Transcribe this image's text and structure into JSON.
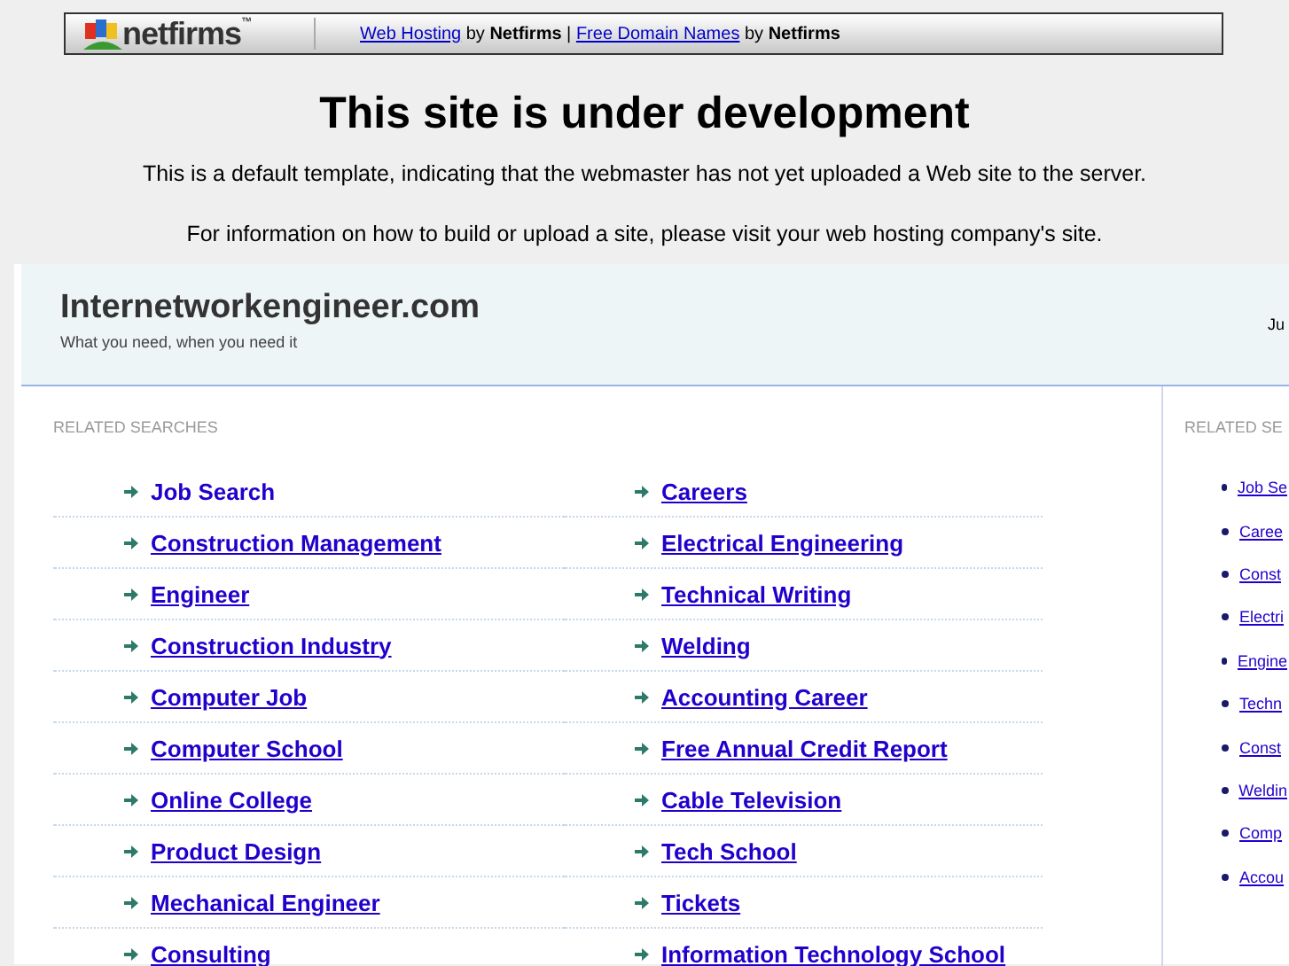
{
  "banner": {
    "logo_text": "netfirms",
    "logo_mark": "™",
    "parts": [
      {
        "kind": "link",
        "text": "Web Hosting"
      },
      {
        "kind": "plain",
        "text": " by "
      },
      {
        "kind": "bold",
        "text": "Netfirms"
      },
      {
        "kind": "plain",
        "text": " | "
      },
      {
        "kind": "link",
        "text": "Free Domain Names"
      },
      {
        "kind": "plain",
        "text": " by "
      },
      {
        "kind": "bold",
        "text": "Netfirms"
      }
    ]
  },
  "heading": "This site is under development",
  "paragraphs": [
    "This is a default template, indicating that the webmaster has not yet uploaded a Web site to the server.",
    "For information on how to build or upload a site, please visit your web hosting company's site."
  ],
  "site": {
    "title": "Internetworkengineer.com",
    "tagline": "What you need, when you need it",
    "header_right": "Ju"
  },
  "related": {
    "title": "RELATED SEARCHES",
    "links": [
      {
        "text": "Job Search",
        "hovered": true
      },
      {
        "text": "Careers",
        "hovered": false
      },
      {
        "text": "Construction Management",
        "hovered": false
      },
      {
        "text": "Electrical Engineering",
        "hovered": false
      },
      {
        "text": "Engineer",
        "hovered": false
      },
      {
        "text": "Technical Writing",
        "hovered": false
      },
      {
        "text": "Construction Industry",
        "hovered": false
      },
      {
        "text": "Welding",
        "hovered": false
      },
      {
        "text": "Computer Job",
        "hovered": false
      },
      {
        "text": "Accounting Career",
        "hovered": false
      },
      {
        "text": "Computer School",
        "hovered": false
      },
      {
        "text": "Free Annual Credit Report",
        "hovered": false
      },
      {
        "text": "Online College",
        "hovered": false
      },
      {
        "text": "Cable Television",
        "hovered": false
      },
      {
        "text": "Product Design",
        "hovered": false
      },
      {
        "text": "Tech School",
        "hovered": false
      },
      {
        "text": "Mechanical Engineer",
        "hovered": false
      },
      {
        "text": "Tickets",
        "hovered": false
      },
      {
        "text": "Consulting",
        "hovered": false
      },
      {
        "text": "Information Technology School",
        "hovered": false
      }
    ]
  },
  "sidebar": {
    "title": "RELATED SE",
    "links": [
      "Job Se",
      "Caree",
      "Const",
      "Electri",
      "Engine",
      "Techn",
      "Const",
      "Weldin",
      "Comp",
      "Accou"
    ]
  }
}
